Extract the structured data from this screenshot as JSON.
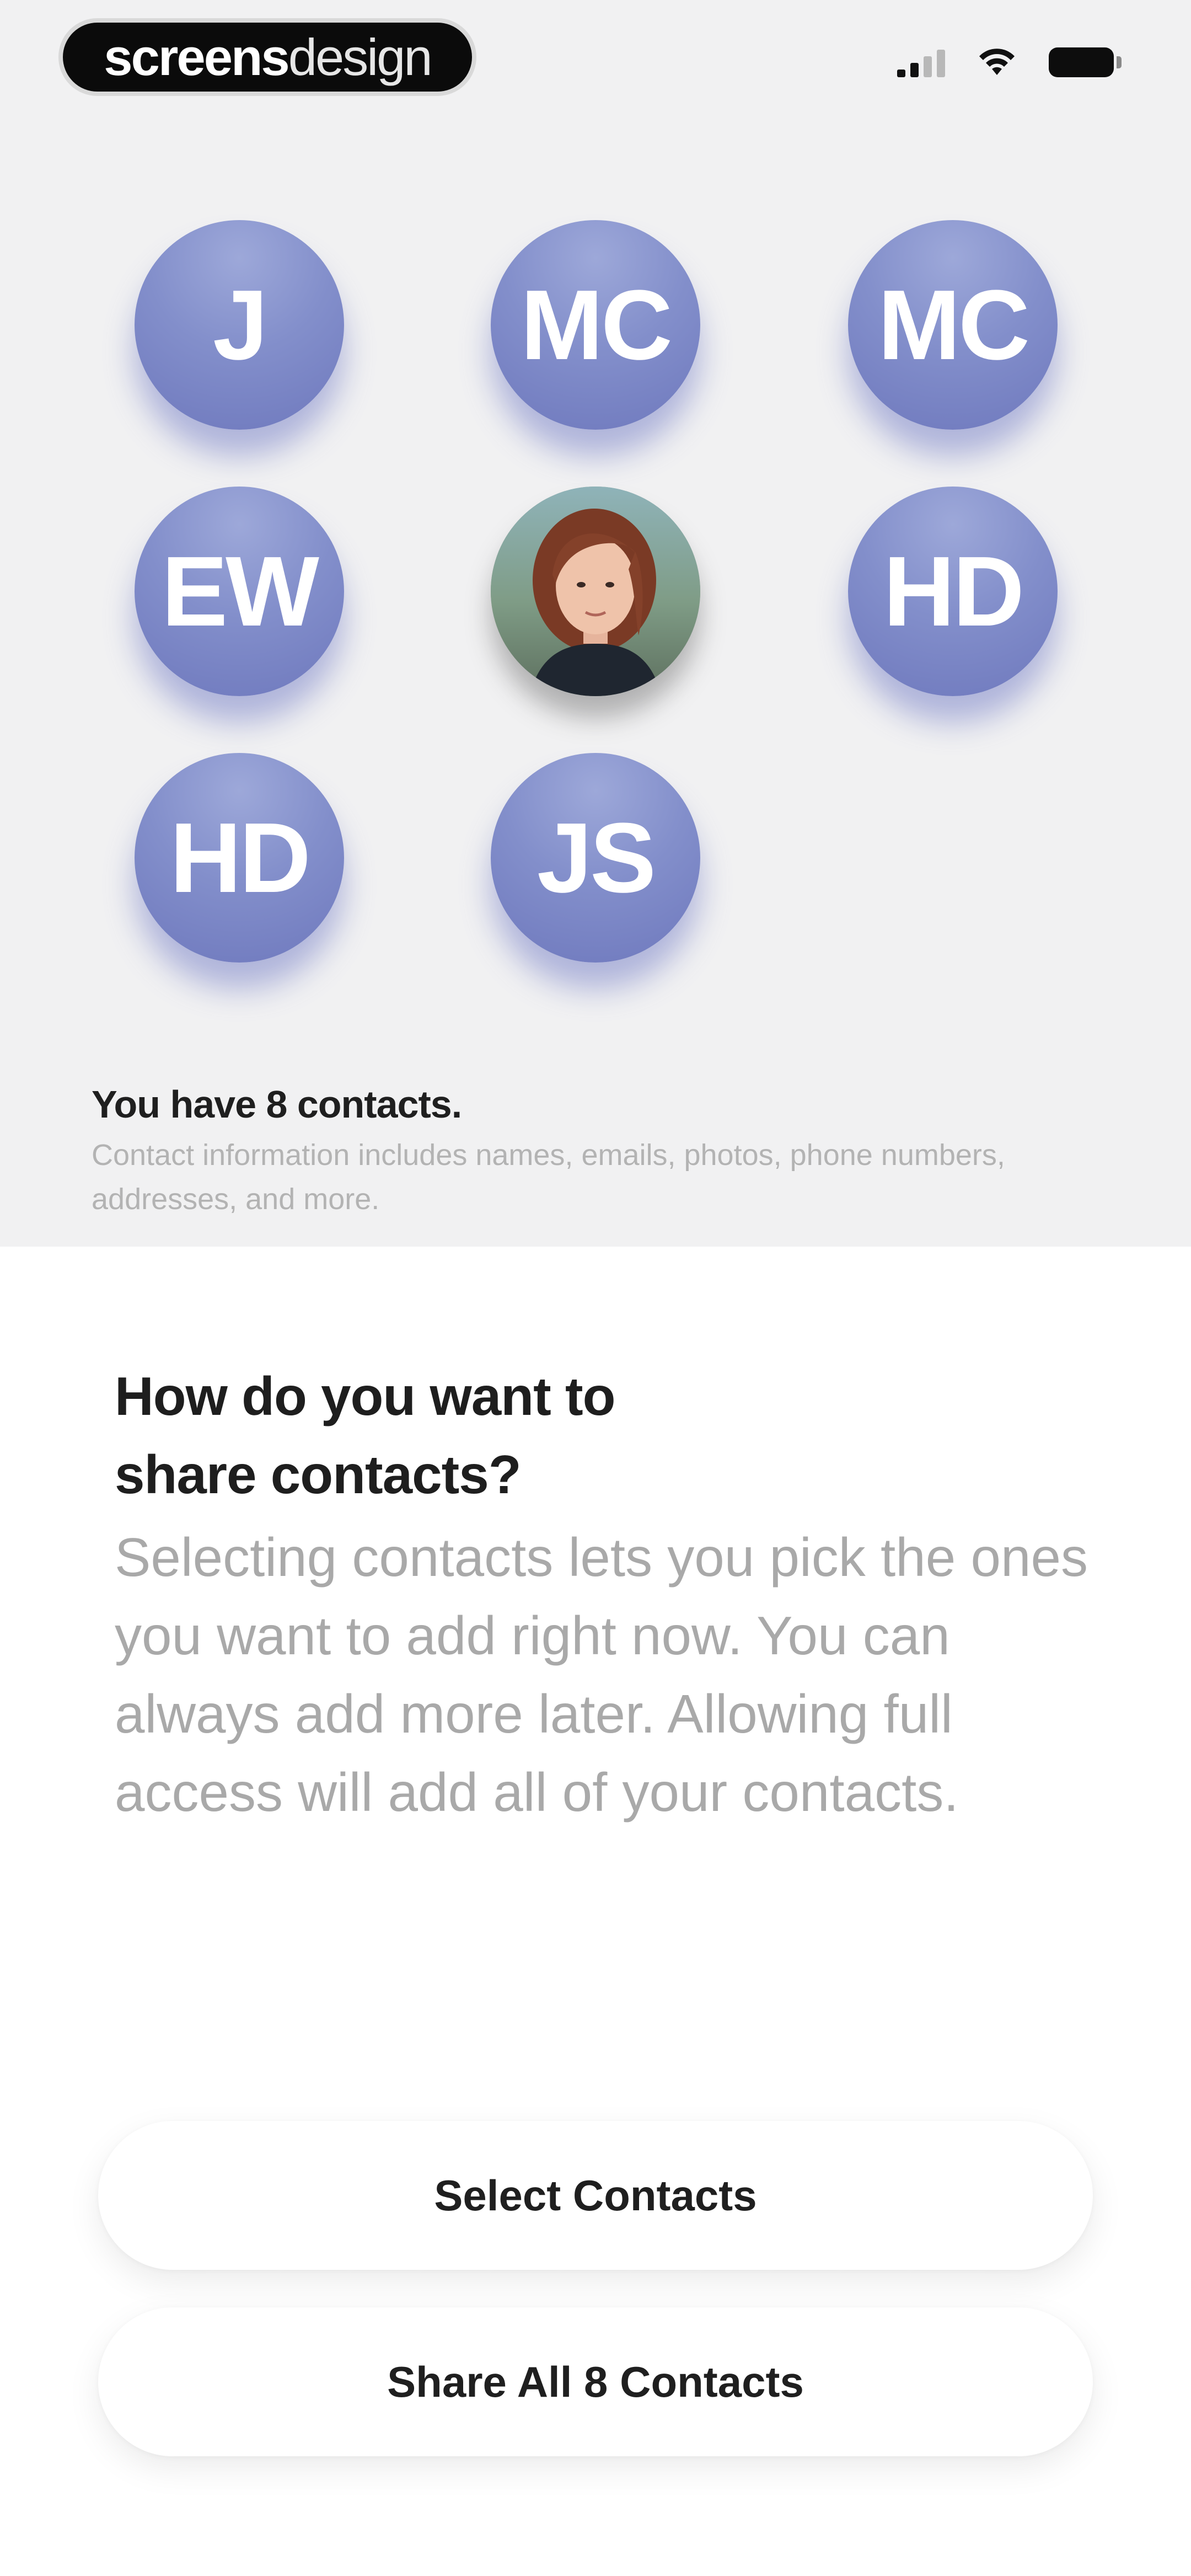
{
  "brand": {
    "bold": "screens",
    "light": "design"
  },
  "status_bar": {
    "icons": [
      "cellular-signal-icon",
      "wifi-icon",
      "battery-icon"
    ]
  },
  "contacts_grid": {
    "avatars": [
      {
        "initials": "J"
      },
      {
        "initials": "MC"
      },
      {
        "initials": "MC"
      },
      {
        "initials": "EW"
      },
      {
        "initials": "",
        "photo": true
      },
      {
        "initials": "HD"
      },
      {
        "initials": "HD"
      },
      {
        "initials": "JS"
      }
    ]
  },
  "summary": {
    "title": "You have 8 contacts.",
    "description": "Contact information includes names, emails, photos, phone numbers, addresses, and more."
  },
  "sheet": {
    "heading_line1": "How do you want to",
    "heading_line2": "share contacts?",
    "body": "Selecting contacts lets you pick the ones you want to add right now. You can always add more later. Allowing full access will add all of your contacts."
  },
  "actions": {
    "select_label": "Select Contacts",
    "share_all_label": "Share All 8 Contacts"
  },
  "colors": {
    "avatar": "#838fcb",
    "top_background": "#f1f1f2",
    "sheet_background": "#ffffff"
  }
}
